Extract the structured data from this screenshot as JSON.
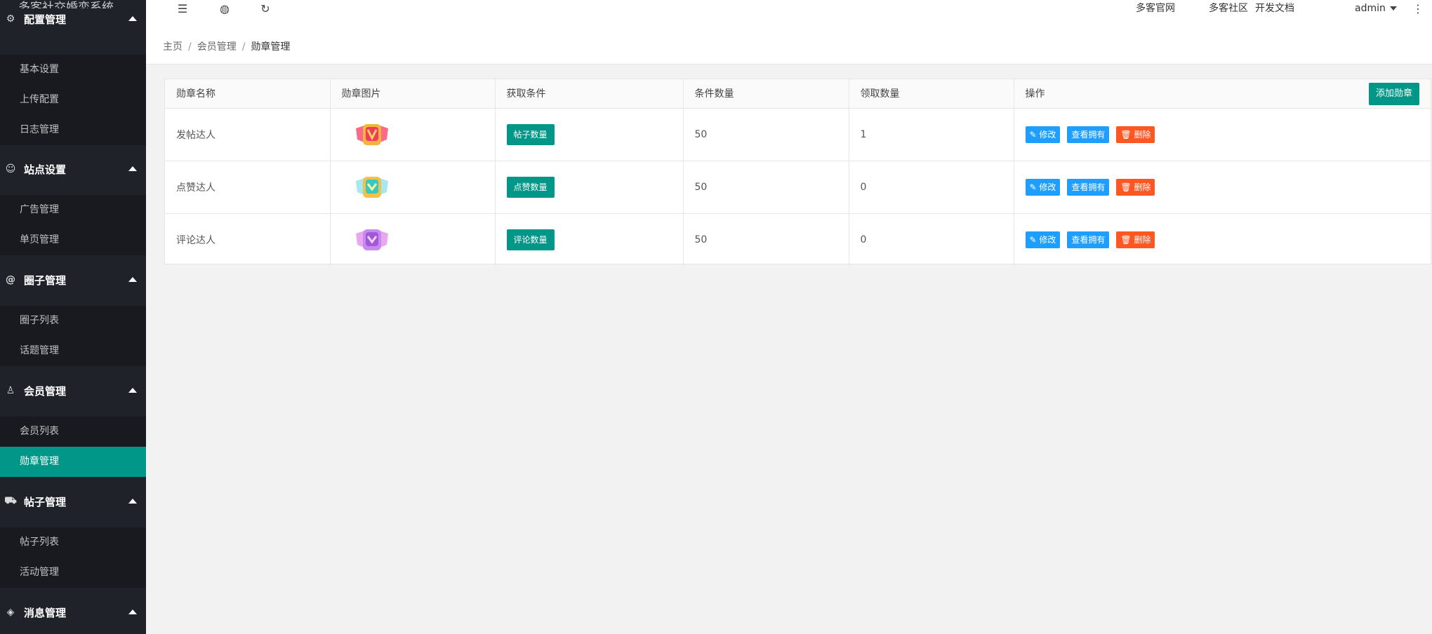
{
  "app": {
    "title": "多客社交婚恋系统"
  },
  "sidebar": {
    "groups": [
      {
        "label": "配置管理",
        "icon": "gear-icon",
        "items": [
          "基本设置",
          "上传配置",
          "日志管理"
        ]
      },
      {
        "label": "站点设置",
        "icon": "site-icon",
        "items": [
          "广告管理",
          "单页管理"
        ]
      },
      {
        "label": "圈子管理",
        "icon": "at-icon",
        "items": [
          "圈子列表",
          "话题管理"
        ]
      },
      {
        "label": "会员管理",
        "icon": "user-icon",
        "items": [
          "会员列表",
          "勋章管理"
        ]
      },
      {
        "label": "帖子管理",
        "icon": "cart-icon",
        "items": [
          "帖子列表",
          "活动管理"
        ]
      },
      {
        "label": "消息管理",
        "icon": "message-icon",
        "items": []
      }
    ],
    "active_item": "勋章管理"
  },
  "header": {
    "links": {
      "official": "多客官网",
      "community": "多客社区",
      "docs": "开发文档"
    },
    "user": "admin",
    "more_icon": "more-vertical-icon"
  },
  "breadcrumb": {
    "home": "主页",
    "parent": "会员管理",
    "current": "勋章管理",
    "sep": "/"
  },
  "table": {
    "headers": [
      "勋章名称",
      "勋章图片",
      "获取条件",
      "条件数量",
      "领取数量",
      "操作"
    ],
    "add_button": "添加勋章",
    "rows": [
      {
        "name": "发帖达人",
        "condition": "帖子数量",
        "count": "50",
        "claimed": "1",
        "badge_color": "#f03a5f"
      },
      {
        "name": "点赞达人",
        "condition": "点赞数量",
        "count": "50",
        "claimed": "0",
        "badge_color": "#36c9c0"
      },
      {
        "name": "评论达人",
        "condition": "评论数量",
        "count": "50",
        "claimed": "0",
        "badge_color": "#a05ad8"
      }
    ],
    "actions": {
      "edit": "修改",
      "view": "查看拥有",
      "delete": "删除"
    }
  }
}
